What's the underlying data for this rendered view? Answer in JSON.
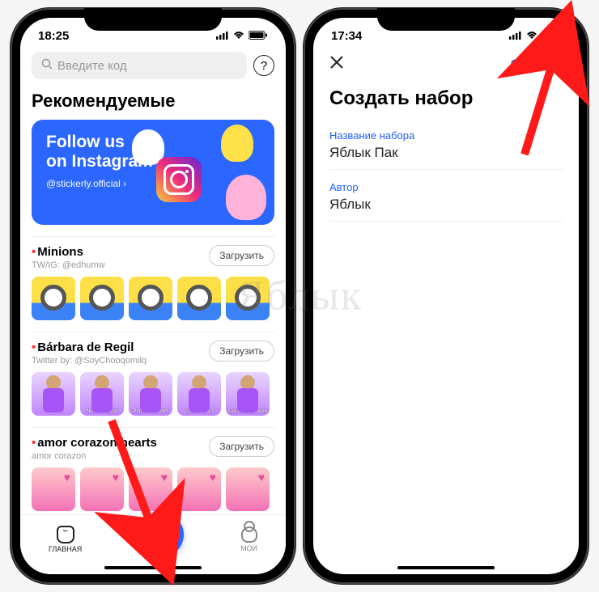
{
  "left": {
    "status": {
      "time": "18:25"
    },
    "search": {
      "placeholder": "Введите код"
    },
    "section_title": "Рекомендуемые",
    "promo": {
      "line1": "Follow us",
      "line2": "on Instagram",
      "handle": "@stickerly.official ›"
    },
    "download_label": "Загрузить",
    "packs": [
      {
        "title": "Minions",
        "subtitle": "TW/IG: @edhumw"
      },
      {
        "title": "Bárbara de Regil",
        "subtitle": "Twitter by: @SoyChooqomilq"
      },
      {
        "title": "amor corazon hearts",
        "subtitle": "amor corazon"
      }
    ],
    "barbara_captions": [
      "",
      "No te conozco",
      "Pon el ejemplo!!",
      "¿Como dice?",
      "Las tentadas sure"
    ],
    "nav": {
      "home": "ГЛАВНАЯ",
      "my": "МОИ"
    }
  },
  "right": {
    "status": {
      "time": "17:34"
    },
    "action": "Создать",
    "title": "Создать набор",
    "field1_label": "Название набора",
    "field1_value": "Яблык Пак",
    "field2_label": "Автор",
    "field2_value": "Яблык"
  },
  "watermark": "Яблык"
}
